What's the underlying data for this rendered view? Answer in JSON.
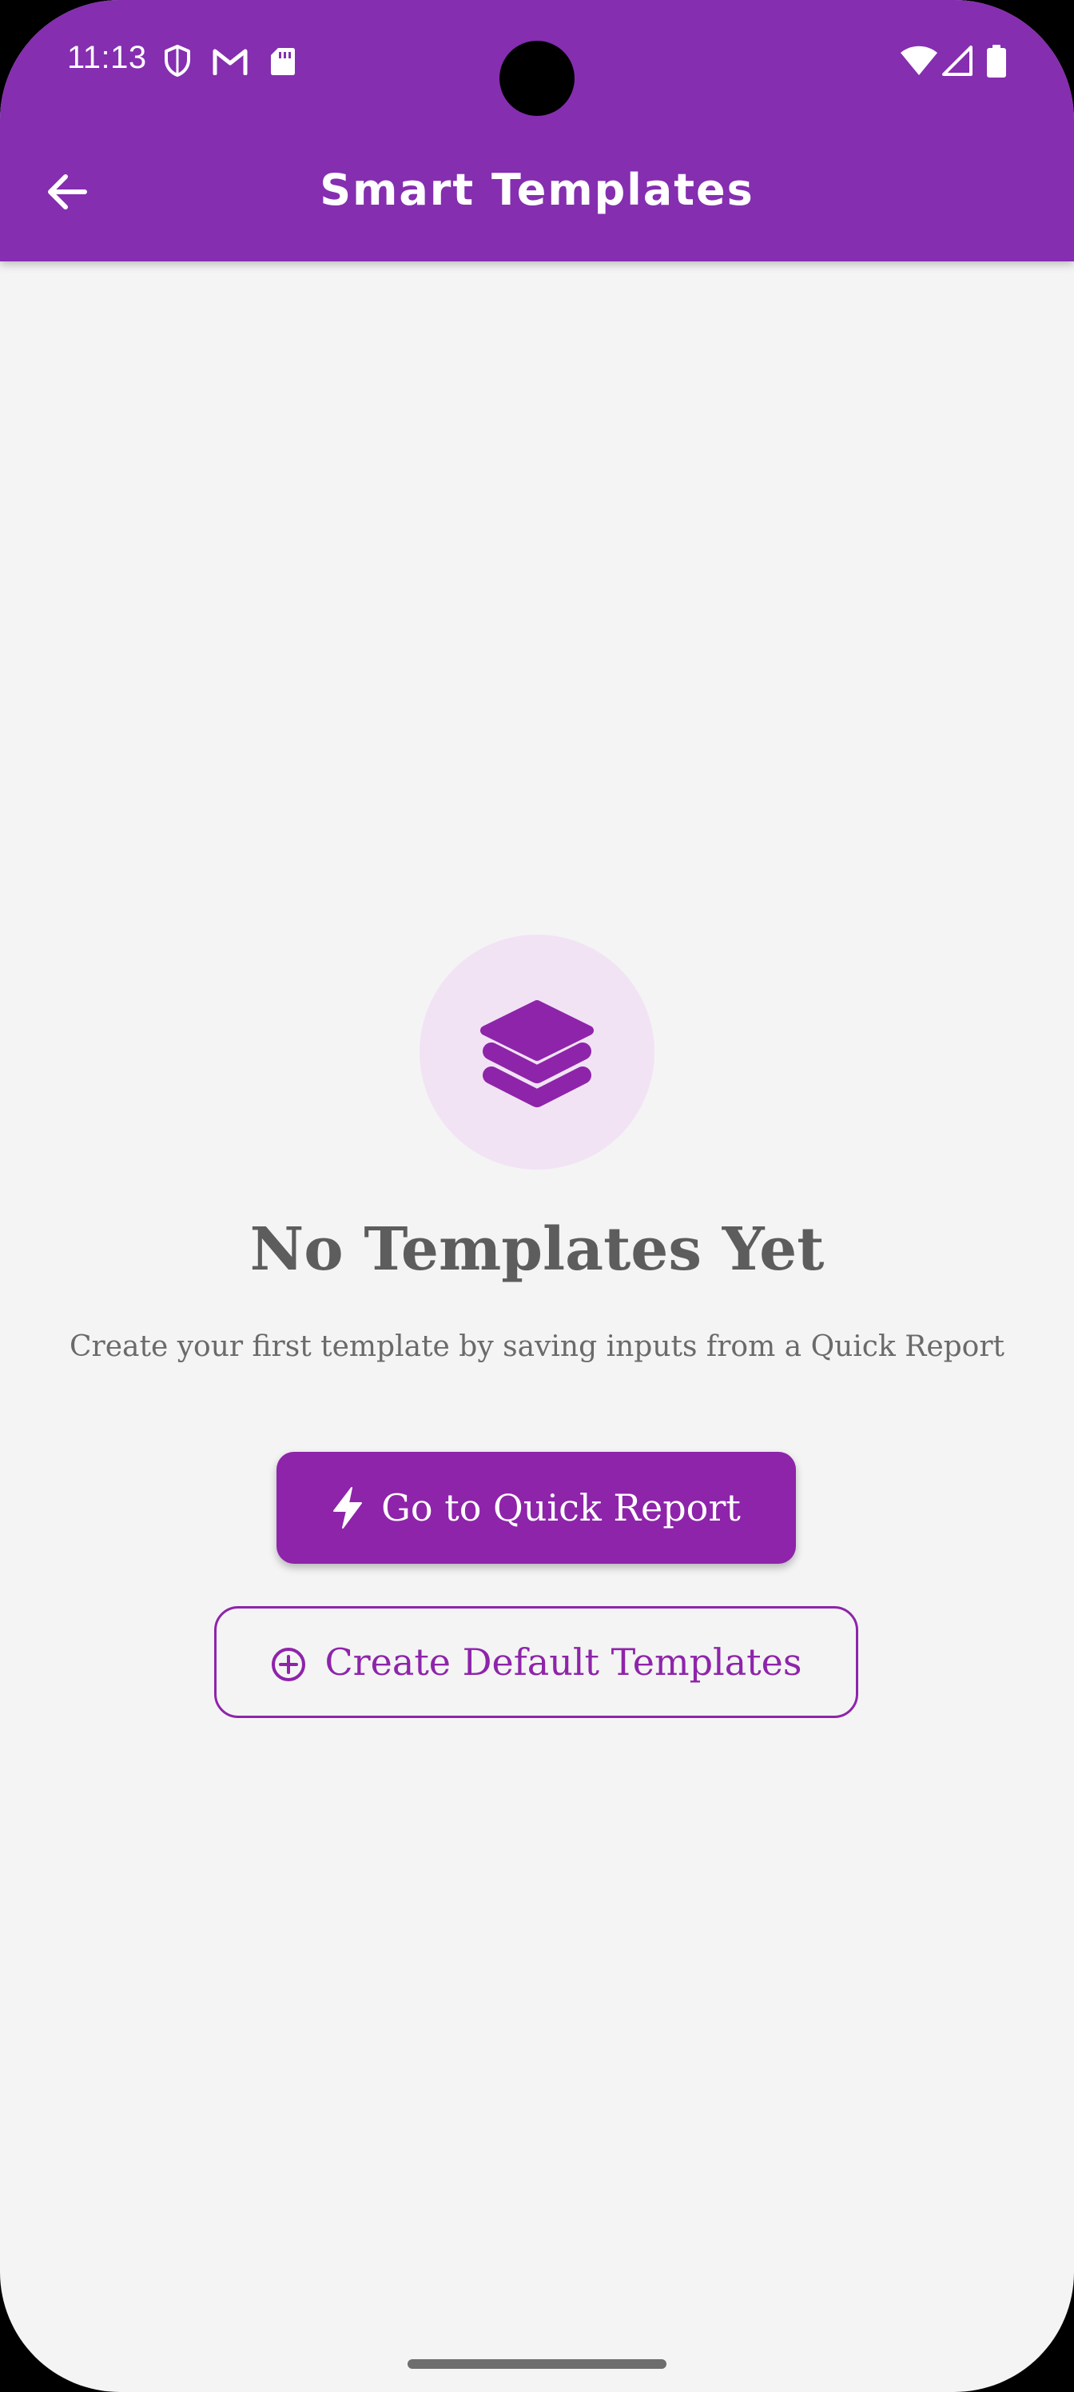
{
  "status_bar": {
    "time": "11:13",
    "left_icons": [
      "shield-icon",
      "gmail-icon",
      "sd-card-icon"
    ],
    "right_icons": [
      "wifi-icon",
      "signal-icon",
      "battery-icon"
    ]
  },
  "app_bar": {
    "title": "Smart Templates",
    "back_icon": "arrow-back-icon",
    "background_color": "#852eb0"
  },
  "empty_state": {
    "icon": "layers-icon",
    "title": "No Templates Yet",
    "subtitle": "Create your first template by saving inputs from a Quick Report"
  },
  "actions": {
    "primary": {
      "icon": "bolt-icon",
      "label": "Go to Quick Report",
      "color": "#8e24aa"
    },
    "secondary": {
      "icon": "add-circle-outline-icon",
      "label": "Create Default Templates",
      "color": "#8e24aa"
    }
  }
}
